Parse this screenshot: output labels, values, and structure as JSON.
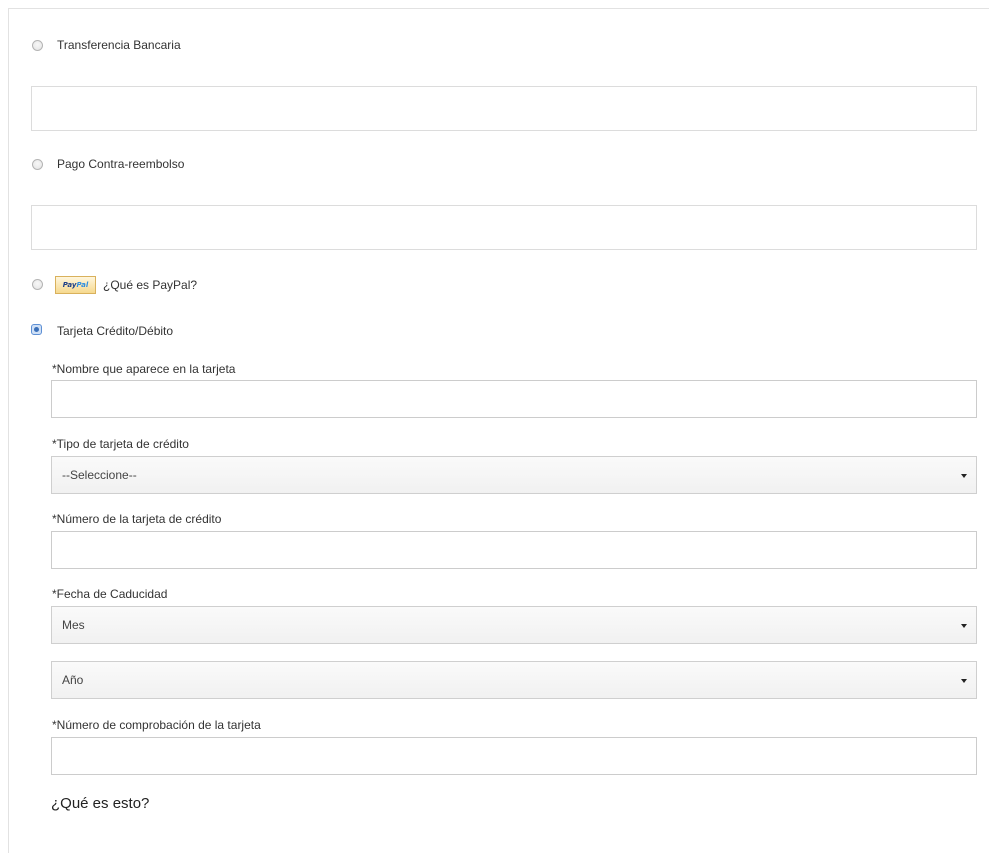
{
  "payment": {
    "options": [
      {
        "label": "Transferencia Bancaria",
        "selected": false
      },
      {
        "label": "Pago Contra-reembolso",
        "selected": false
      },
      {
        "label": "¿Qué es PayPal?",
        "selected": false,
        "logo_text_1": "Pay",
        "logo_text_2": "Pal"
      },
      {
        "label": "Tarjeta Crédito/Débito",
        "selected": true
      }
    ]
  },
  "card_form": {
    "name_label": "*Nombre que aparece en la tarjeta",
    "name_value": "",
    "type_label": "*Tipo de tarjeta de crédito",
    "type_selected": "--Seleccione--",
    "number_label": "*Número de la tarjeta de crédito",
    "number_value": "",
    "expiry_label": "*Fecha de Caducidad",
    "month_selected": "Mes",
    "year_selected": "Año",
    "cvv_label": "*Número de comprobación de la tarjeta",
    "cvv_value": "",
    "help_link": "¿Qué es esto?"
  },
  "colors": {
    "border": "#dcdcdc",
    "radio_checked": "#3a6fb8",
    "text": "#333333"
  }
}
